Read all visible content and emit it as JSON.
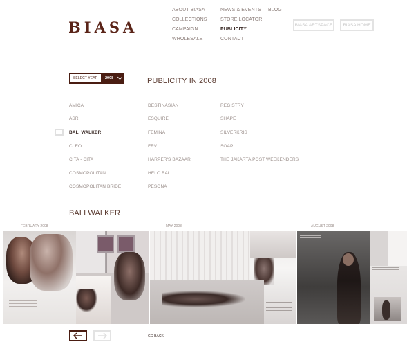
{
  "logo": "BIASA",
  "nav": {
    "col1": [
      "ABOUT BIASA",
      "COLLECTIONS",
      "CAMPAIGN",
      "WHOLESALE"
    ],
    "col2": [
      "NEWS & EVENTS",
      "STORE LOCATOR",
      "PUBLICITY",
      "CONTACT"
    ],
    "col3": [
      "BLOG"
    ]
  },
  "buttons": {
    "artspace": "BIASA ARTSPACE",
    "home": "BIASA HOME"
  },
  "select_year": {
    "label": "SELECT YEAR",
    "value": "2008"
  },
  "title": "PUBLICITY IN 2008",
  "publications": {
    "col1": [
      "AMICA",
      "ASRI",
      "BALI WALKER",
      "CLEO",
      "CITA - CITA",
      "COSMOPOLITAN",
      "COSMOPOLITAN BRIDE"
    ],
    "col2": [
      "DESTINASIAN",
      "ESQUIRE",
      "FEMINA",
      "FRV",
      "HARPER'S BAZAAR",
      "HELO BALI",
      "PESONA"
    ],
    "col3": [
      "REGISTRY",
      "SHAPE",
      "SILVERKRIS",
      "SOAP",
      "THE JAKARTA POST WEEKENDERS"
    ],
    "active": "BALI WALKER"
  },
  "section_title": "BALI WALKER",
  "gallery_dates": [
    "FEBRUARY 2008",
    "MAY 2008",
    "AUGUST 2008"
  ],
  "pagination": {
    "prev_icon": "arrow-left-icon",
    "next_icon": "arrow-right-icon",
    "go_back": "GO BACK"
  },
  "colors": {
    "brand": "#4a1d12",
    "muted": "#9a8e8a",
    "ghost": "#e3e3e3"
  }
}
